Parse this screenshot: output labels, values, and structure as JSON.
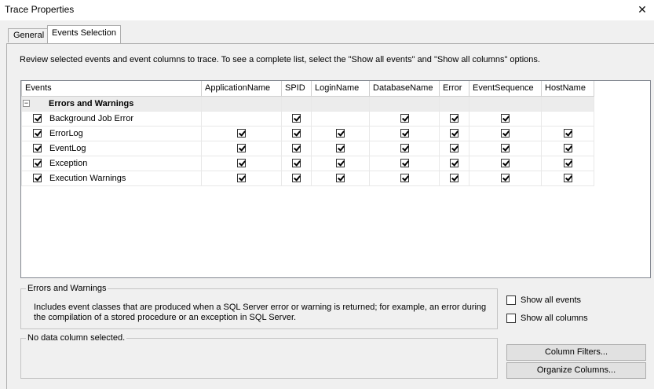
{
  "window": {
    "title": "Trace Properties",
    "close_glyph": "✕"
  },
  "tabs": [
    {
      "label": "General"
    },
    {
      "label": "Events Selection"
    }
  ],
  "instructions": "Review selected events and event columns to trace. To see a complete list, select the \"Show all events\" and \"Show all columns\" options.",
  "grid": {
    "columns": [
      "Events",
      "ApplicationName",
      "SPID",
      "LoginName",
      "DatabaseName",
      "Error",
      "EventSequence",
      "HostName"
    ],
    "category": {
      "label": "Errors and Warnings",
      "expander": "−"
    },
    "rows": [
      {
        "name": "Background Job Error",
        "checked": true,
        "cols": [
          false,
          true,
          false,
          true,
          true,
          true,
          false
        ]
      },
      {
        "name": "ErrorLog",
        "checked": true,
        "cols": [
          true,
          true,
          true,
          true,
          true,
          true,
          true
        ]
      },
      {
        "name": "EventLog",
        "checked": true,
        "cols": [
          true,
          true,
          true,
          true,
          true,
          true,
          true
        ]
      },
      {
        "name": "Exception",
        "checked": true,
        "cols": [
          true,
          true,
          true,
          true,
          true,
          true,
          true
        ]
      },
      {
        "name": "Execution Warnings",
        "checked": true,
        "cols": [
          true,
          true,
          true,
          true,
          true,
          true,
          true
        ]
      }
    ]
  },
  "event_description": {
    "title": "Errors and Warnings",
    "text": "Includes event classes that are produced when a SQL Server error or warning is returned; for example, an error during the compilation of a stored procedure or an exception in SQL Server."
  },
  "column_description": {
    "title": "No data column selected."
  },
  "options": {
    "show_all_events": "Show all events",
    "show_all_columns": "Show all columns"
  },
  "buttons": {
    "column_filters": "Column Filters...",
    "organize_columns": "Organize Columns..."
  }
}
